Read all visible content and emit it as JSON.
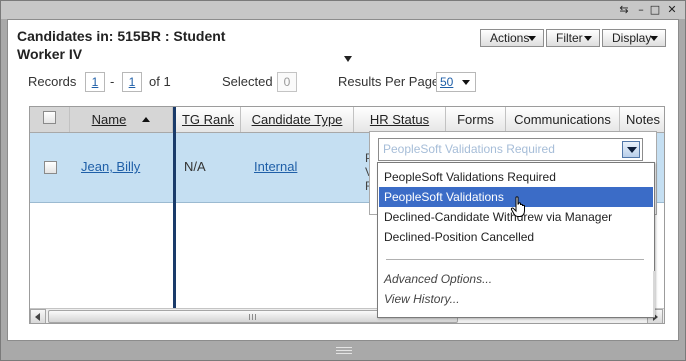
{
  "window": {
    "controls": {
      "restore": "⇆",
      "minimize": "–",
      "maximize": "□",
      "close": "✕"
    }
  },
  "header": {
    "title": "Candidates in: 515BR : Student Worker IV",
    "actions_label": "Actions",
    "filter_label": "Filter",
    "display_label": "Display"
  },
  "paging": {
    "records_label": "Records",
    "from": "1",
    "sep": "-",
    "to": "1",
    "of_label": "of 1",
    "selected_label": "Selected",
    "selected_count": "0",
    "rpp_label": "Results Per Page",
    "rpp_value": "50"
  },
  "table": {
    "headers": {
      "name": "Name",
      "tg_rank": "TG Rank",
      "candidate_type": "Candidate Type",
      "hr_status": "HR Status",
      "forms": "Forms",
      "communications": "Communications",
      "notes": "Notes"
    },
    "row": {
      "name": "Jean, Billy",
      "tg_rank": "N/A",
      "candidate_type": "Internal",
      "hr_fragments": [
        "Pe",
        "Va",
        "Re"
      ]
    }
  },
  "hr_dropdown": {
    "current_value": "PeopleSoft Validations Required",
    "options": [
      "PeopleSoft Validations Required",
      "PeopleSoft Validations",
      "Declined-Candidate Withdrew via Manager",
      "Declined-Position Cancelled"
    ],
    "selected_index": 1,
    "advanced_options": "Advanced Options...",
    "view_history": "View History..."
  },
  "colors": {
    "row_highlight": "#c5dff2",
    "option_selected": "#3b6cc7",
    "link": "#1f5fa8",
    "divider": "#1a3b6a"
  }
}
